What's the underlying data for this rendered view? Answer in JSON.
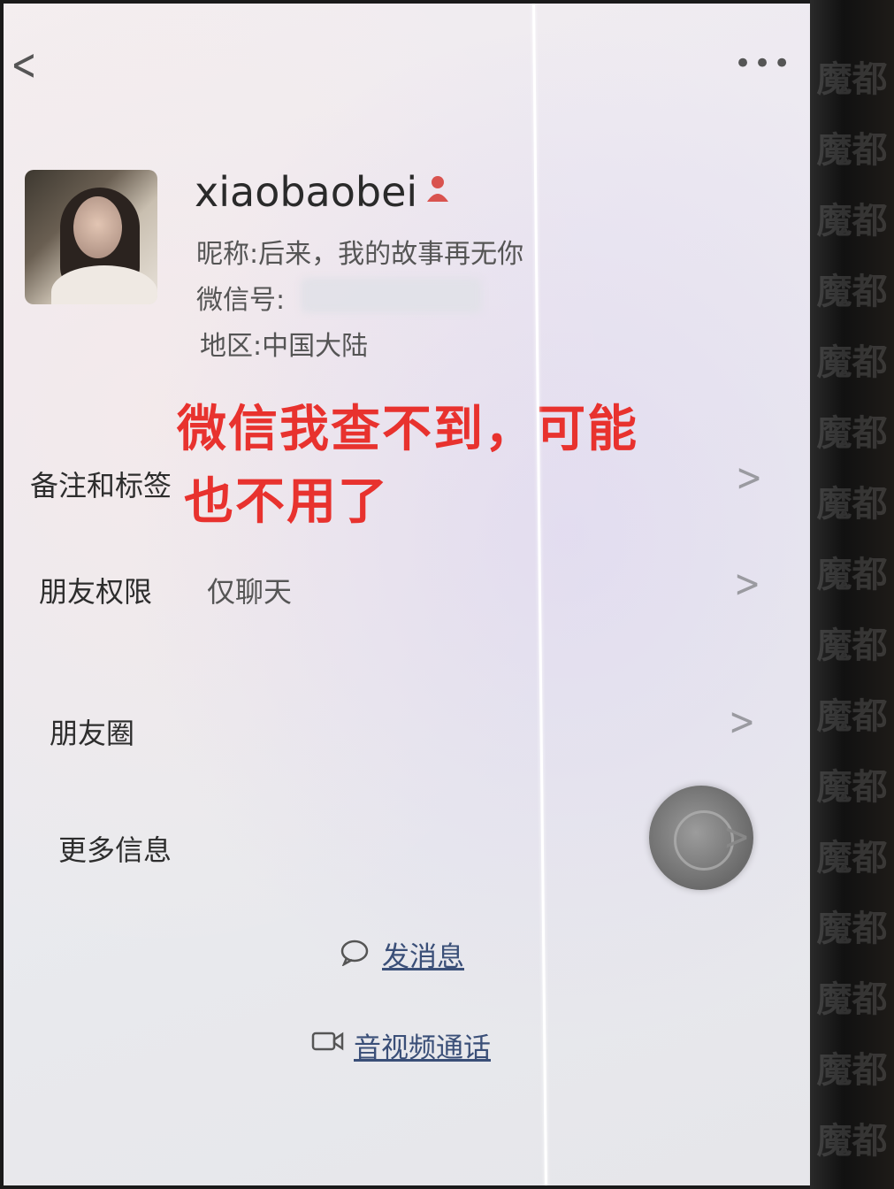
{
  "header": {
    "back_icon": "chevron-left-icon",
    "more_icon": "more-dots-icon",
    "more_text": "•••"
  },
  "profile": {
    "username": "xiaobaobei",
    "nickname_line": "昵称:后来，我的故事再无你",
    "wechat_id_label": "微信号:",
    "region_line": "地区:中国大陆",
    "gender_icon": "female-person-icon"
  },
  "overlay_annotation": {
    "line1": "微信我查不到，可能",
    "line2": "也不用了",
    "color": "#e8322e"
  },
  "menu": {
    "remarks_label": "备注和标签",
    "permissions_label": "朋友权限",
    "permissions_value": "仅聊天",
    "moments_label": "朋友圈",
    "more_info_label": "更多信息"
  },
  "actions": {
    "send_message": "发消息",
    "av_call": "音视频通话"
  },
  "watermark": {
    "text": "魔都"
  }
}
